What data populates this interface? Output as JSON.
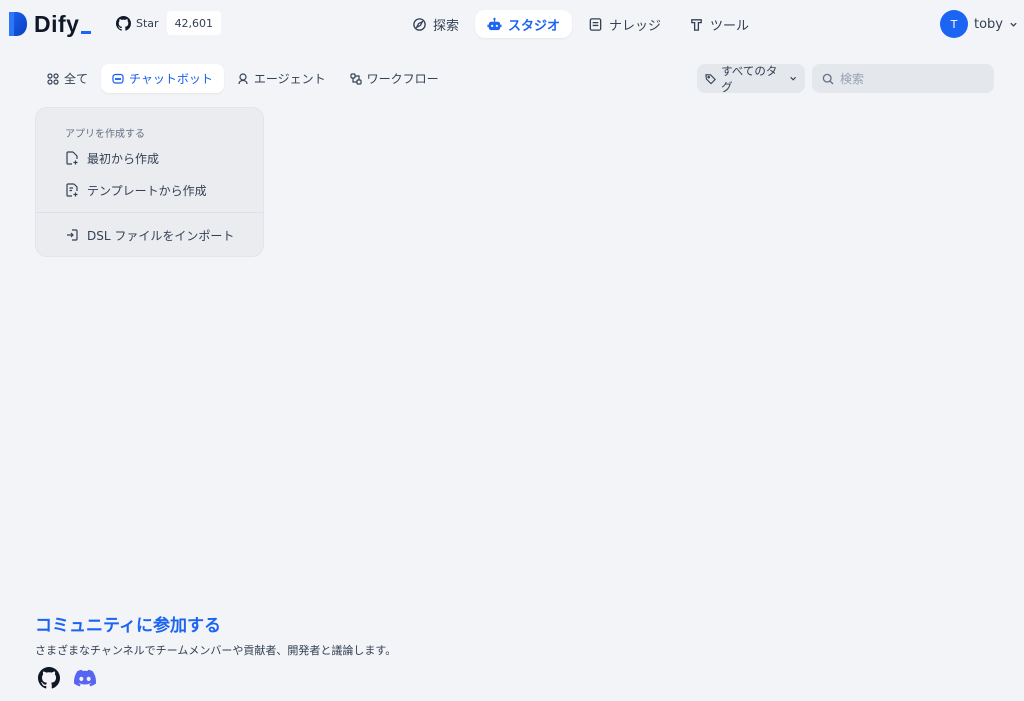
{
  "header": {
    "logo_text": "Dify",
    "github": {
      "star_label": "Star",
      "star_count": "42,601"
    },
    "nav": [
      {
        "label": "探索",
        "icon": "explore-icon",
        "active": false
      },
      {
        "label": "スタジオ",
        "icon": "robot-icon",
        "active": true
      },
      {
        "label": "ナレッジ",
        "icon": "book-icon",
        "active": false
      },
      {
        "label": "ツール",
        "icon": "tool-icon",
        "active": false
      }
    ],
    "user": {
      "avatar_initial": "T",
      "name": "toby"
    }
  },
  "filters": {
    "tabs": [
      {
        "label": "全て",
        "icon": "grid-icon",
        "active": false
      },
      {
        "label": "チャットボット",
        "icon": "chat-icon",
        "active": true
      },
      {
        "label": "エージェント",
        "icon": "agent-icon",
        "active": false
      },
      {
        "label": "ワークフロー",
        "icon": "workflow-icon",
        "active": false
      }
    ],
    "tag_select": "すべてのタグ",
    "search_placeholder": "検索"
  },
  "create_app": {
    "title": "アプリを作成する",
    "blank": "最初から作成",
    "template": "テンプレートから作成",
    "import_dsl": "DSL ファイルをインポート"
  },
  "community": {
    "title": "コミュニティに参加する",
    "description": "さまざまなチャンネルでチームメンバーや貢献者、開発者と議論します。"
  },
  "colors": {
    "accent": "#1c64f2",
    "background": "#f2f4f7",
    "discord": "#5865f2"
  }
}
